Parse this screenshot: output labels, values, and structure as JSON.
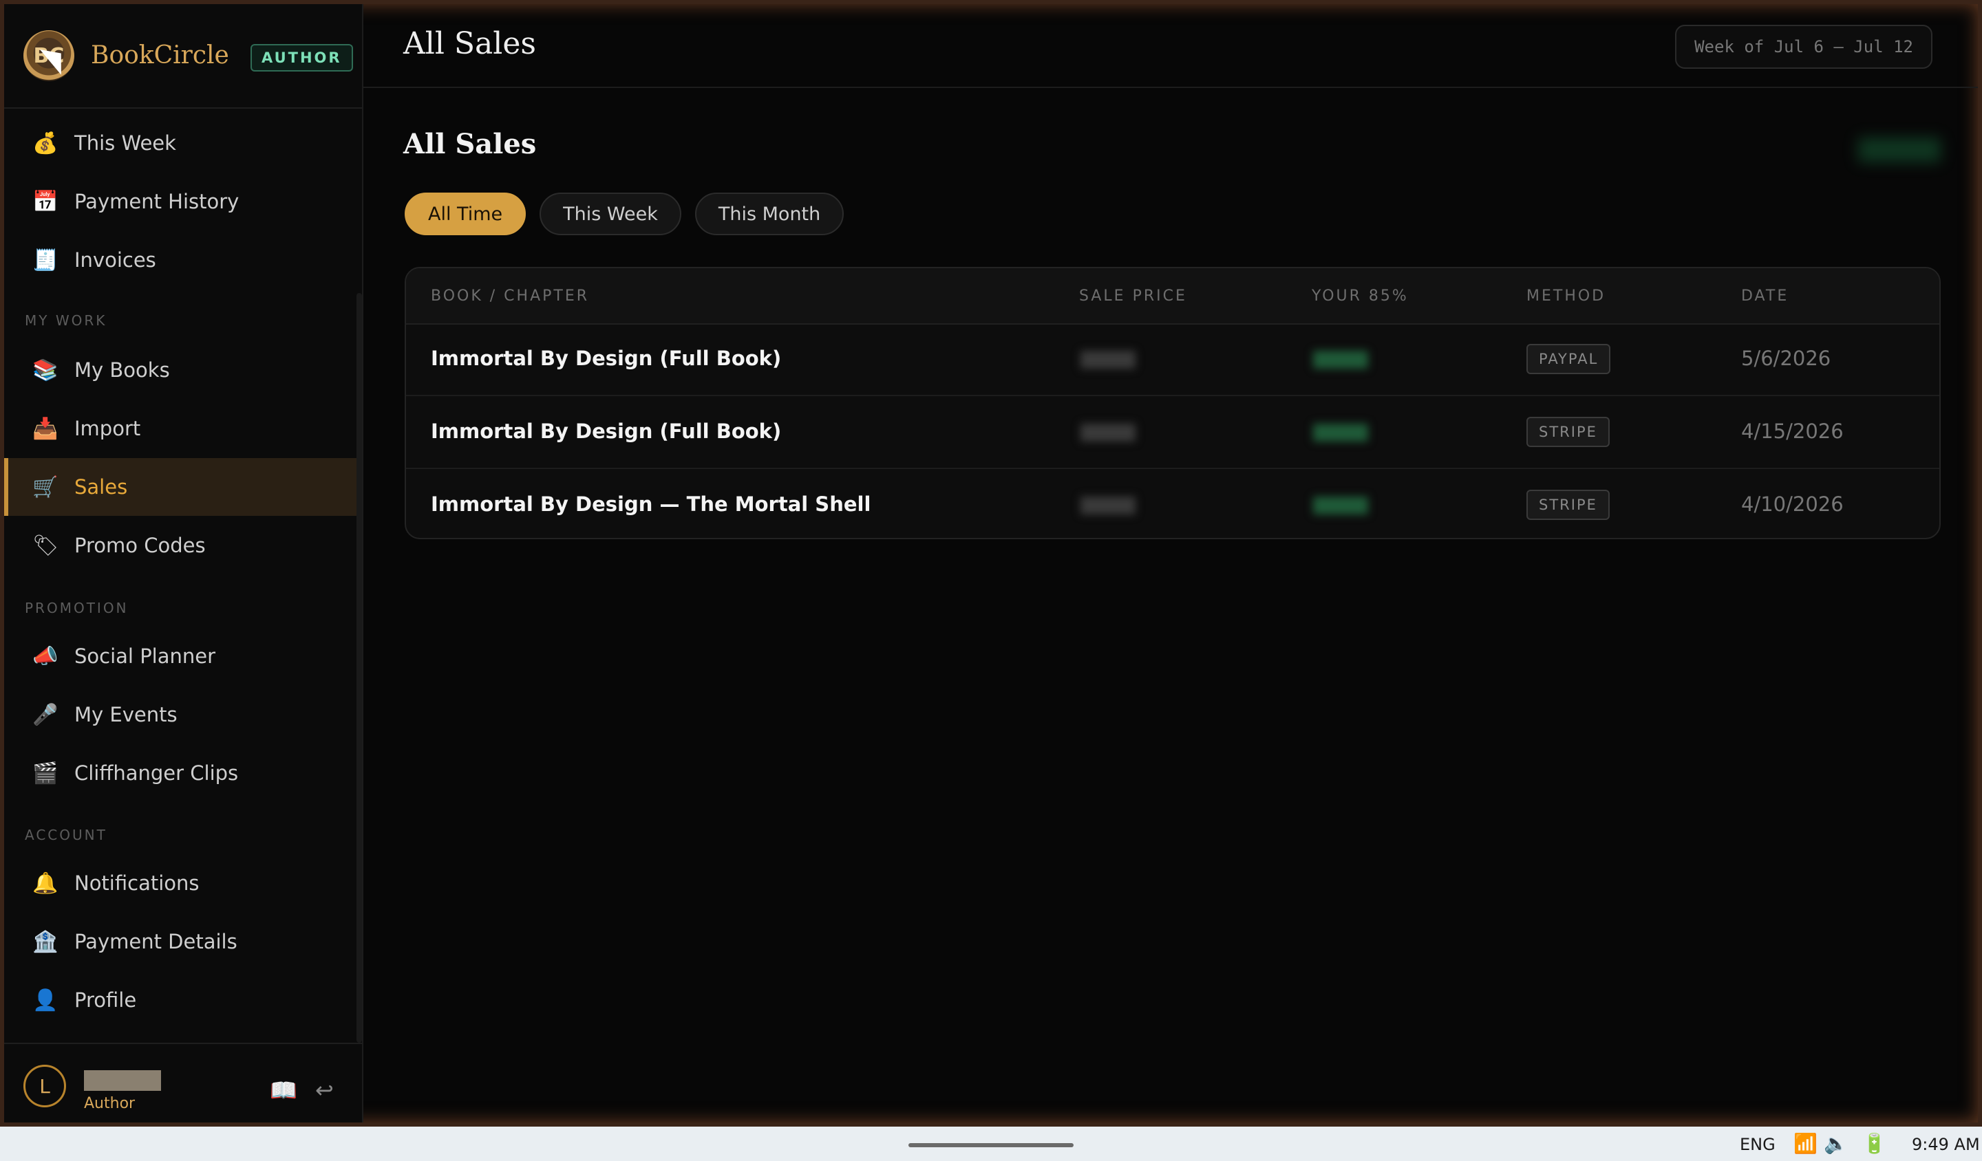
{
  "app": {
    "brand": "BookCircle",
    "logo_text": "BC",
    "role_badge": "AUTHOR"
  },
  "sidebar": {
    "top_items": [
      {
        "label": "This Week",
        "icon": "💰"
      },
      {
        "label": "Payment History",
        "icon": "📅"
      },
      {
        "label": "Invoices",
        "icon": "🧾"
      }
    ],
    "sections": {
      "my_work": "MY WORK",
      "promotion": "PROMOTION",
      "account": "ACCOUNT"
    },
    "my_work_items": [
      {
        "label": "My Books",
        "icon": "📚"
      },
      {
        "label": "Import",
        "icon": "📥"
      },
      {
        "label": "Sales",
        "icon": "🛒"
      },
      {
        "label": "Promo Codes",
        "icon": "🏷"
      }
    ],
    "promotion_items": [
      {
        "label": "Social Planner",
        "icon": "📣"
      },
      {
        "label": "My Events",
        "icon": "🎤"
      },
      {
        "label": "Cliffhanger Clips",
        "icon": "🎬"
      }
    ],
    "account_items": [
      {
        "label": "Notifications",
        "icon": "🔔"
      },
      {
        "label": "Payment Details",
        "icon": "🏦"
      },
      {
        "label": "Profile",
        "icon": "👤"
      }
    ],
    "active": "Sales"
  },
  "user": {
    "initial": "L",
    "role": "Author",
    "book_icon": "📖",
    "logout_icon": "↩"
  },
  "header": {
    "title": "All Sales",
    "week_range": "Week of Jul 6 – Jul 12"
  },
  "main": {
    "heading": "All Sales",
    "filters": [
      "All Time",
      "This Week",
      "This Month"
    ],
    "active_filter": "All Time",
    "table": {
      "columns": [
        "BOOK / CHAPTER",
        "SALE PRICE",
        "YOUR 85%",
        "METHOD",
        "DATE"
      ],
      "rows": [
        {
          "title": "Immortal By Design (Full Book)",
          "method": "PAYPAL",
          "date": "5/6/2026"
        },
        {
          "title": "Immortal By Design (Full Book)",
          "method": "STRIPE",
          "date": "4/15/2026"
        },
        {
          "title": "Immortal By Design — The Mortal Shell",
          "method": "STRIPE",
          "date": "4/10/2026"
        }
      ]
    }
  },
  "taskbar": {
    "language": "ENG",
    "time": "9:49 AM"
  },
  "colors": {
    "accent": "#d6a042",
    "badge_green": "#7de0b8",
    "background": "#070707"
  }
}
